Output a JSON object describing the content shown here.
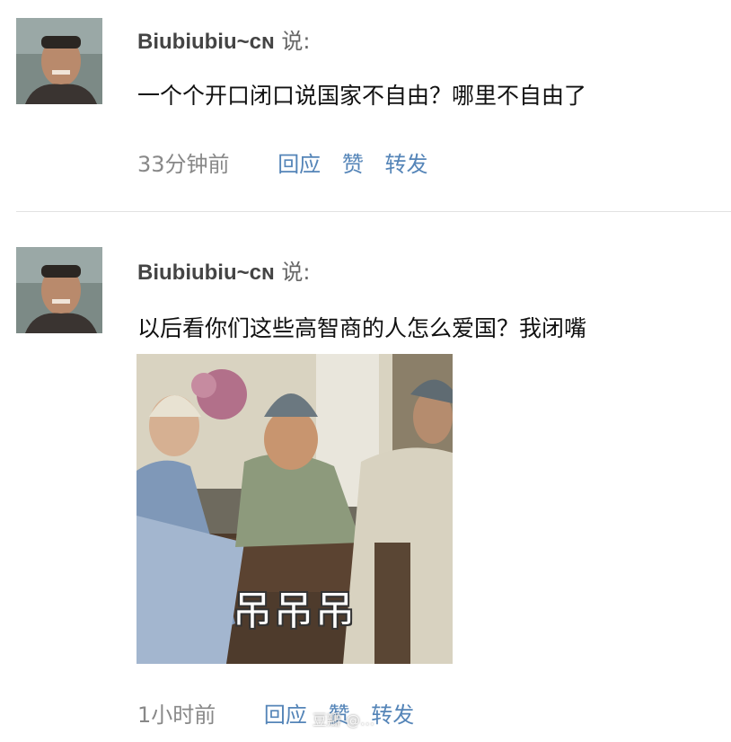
{
  "comments": [
    {
      "author": "Biubiubiu~ᴄɴ",
      "says": "说:",
      "text": "一个个开口闭口说国家不自由？哪里不自由了",
      "time": "33分钟前",
      "actions": [
        "回应",
        "赞",
        "转发"
      ]
    },
    {
      "author": "Biubiubiu~ᴄɴ",
      "says": "说:",
      "text": "以后看你们这些高智商的人怎么爱国？我闭嘴",
      "image_caption": "吊吊吊",
      "time": "1小时前",
      "actions": [
        "回应",
        "赞",
        "转发"
      ]
    }
  ],
  "watermark": "豆瓣 @…",
  "colors": {
    "link": "#5585b8",
    "meta": "#888888",
    "divider": "#e2e2e2"
  }
}
